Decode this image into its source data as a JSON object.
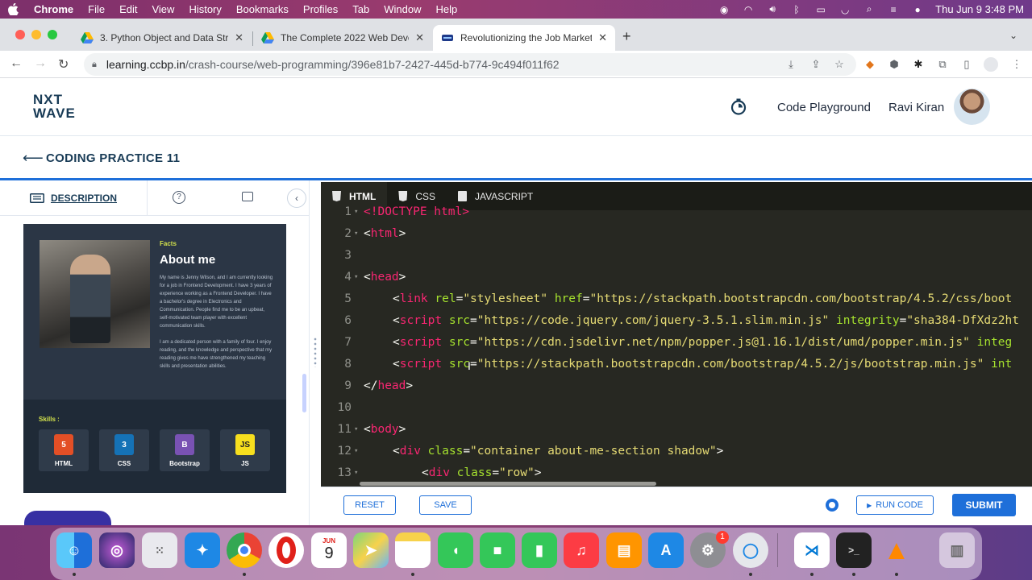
{
  "menubar": {
    "app": "Chrome",
    "items": [
      "File",
      "Edit",
      "View",
      "History",
      "Bookmarks",
      "Profiles",
      "Tab",
      "Window",
      "Help"
    ],
    "clock": "Thu Jun 9  3:48 PM"
  },
  "tabs": [
    {
      "title": "3. Python Object and Data Stru",
      "icon": "google-drive-icon"
    },
    {
      "title": "The Complete 2022 Web Devel",
      "icon": "google-drive-icon"
    },
    {
      "title": "Revolutionizing the Job Market",
      "icon": "ccbp-icon",
      "active": true
    }
  ],
  "address": {
    "host": "learning.ccbp.in",
    "path": "/crash-course/web-programming/396e81b7-2427-445d-b774-9c494f011f62"
  },
  "site": {
    "logo_line1": "NXT",
    "logo_line2": "WAVE",
    "playground": "Code Playground",
    "user": "Ravi Kiran"
  },
  "practice": {
    "title": "CODING PRACTICE 11"
  },
  "description_tab": {
    "label": "DESCRIPTION"
  },
  "preview": {
    "facts": "Facts",
    "heading": "About me",
    "para1": "My name is Jenny Wilson, and I am currently looking for a job in Frontend Development. I have 3 years of experience working as a Frontend Developer. I have a bachelor's degree in Electronics and Communication. People find me to be an upbeat, self-motivated team player with excellent communication skills.",
    "para2": "I am a dedicated person with a family of four. I enjoy reading, and the knowledge and perspective that my reading gives me have strengthened my teaching skills and presentation abilities.",
    "skills_label": "Skills :",
    "skills": [
      {
        "name": "HTML",
        "logo": "5",
        "color": "#e34f26"
      },
      {
        "name": "CSS",
        "logo": "3",
        "color": "#1572b6"
      },
      {
        "name": "Bootstrap",
        "logo": "B",
        "color": "#7952b3"
      },
      {
        "name": "JS",
        "logo": "JS",
        "color": "#f7df1e"
      }
    ]
  },
  "editor": {
    "tabs": [
      "HTML",
      "CSS",
      "JAVASCRIPT"
    ],
    "lines": [
      {
        "n": "1",
        "fold": true,
        "indent": 0,
        "parts": [
          [
            "tag",
            "<!DOCTYPE html>"
          ]
        ]
      },
      {
        "n": "2",
        "fold": true,
        "indent": 0,
        "parts": [
          [
            "punc",
            "<"
          ],
          [
            "tag",
            "html"
          ],
          [
            "punc",
            ">"
          ]
        ]
      },
      {
        "n": "3",
        "fold": false,
        "indent": 0,
        "parts": []
      },
      {
        "n": "4",
        "fold": true,
        "indent": 0,
        "parts": [
          [
            "punc",
            "<"
          ],
          [
            "tag",
            "head"
          ],
          [
            "punc",
            ">"
          ]
        ]
      },
      {
        "n": "5",
        "fold": false,
        "indent": 1,
        "parts": [
          [
            "punc",
            "<"
          ],
          [
            "tag",
            "link "
          ],
          [
            "attr",
            "rel"
          ],
          [
            "punc",
            "="
          ],
          [
            "str",
            "\"stylesheet\" "
          ],
          [
            "attr",
            "href"
          ],
          [
            "punc",
            "="
          ],
          [
            "str",
            "\"https://stackpath.bootstrapcdn.com/bootstrap/4.5.2/css/boot"
          ]
        ]
      },
      {
        "n": "6",
        "fold": false,
        "indent": 1,
        "parts": [
          [
            "punc",
            "<"
          ],
          [
            "tag",
            "script "
          ],
          [
            "attr",
            "src"
          ],
          [
            "punc",
            "="
          ],
          [
            "str",
            "\"https://code.jquery.com/jquery-3.5.1.slim.min.js\" "
          ],
          [
            "attr",
            "integrity"
          ],
          [
            "punc",
            "="
          ],
          [
            "str",
            "\"sha384-DfXdz2ht"
          ]
        ]
      },
      {
        "n": "7",
        "fold": false,
        "indent": 1,
        "parts": [
          [
            "punc",
            "<"
          ],
          [
            "tag",
            "script "
          ],
          [
            "attr",
            "src"
          ],
          [
            "punc",
            "="
          ],
          [
            "str",
            "\"https://cdn.jsdelivr.net/npm/popper.js@1.16.1/dist/umd/popper.min.js\" "
          ],
          [
            "attr",
            "integ"
          ]
        ]
      },
      {
        "n": "8",
        "fold": false,
        "indent": 1,
        "parts": [
          [
            "punc",
            "<"
          ],
          [
            "tag",
            "script "
          ],
          [
            "attr",
            "src"
          ],
          [
            "punc",
            "="
          ],
          [
            "str",
            "\"https://stackpath.bootstrapcdn.com/bootstrap/4.5.2/js/bootstrap.min.js\" "
          ],
          [
            "attr",
            "int"
          ]
        ]
      },
      {
        "n": "9",
        "fold": false,
        "indent": 0,
        "parts": [
          [
            "punc",
            "</"
          ],
          [
            "tag",
            "head"
          ],
          [
            "punc",
            ">"
          ]
        ]
      },
      {
        "n": "10",
        "fold": false,
        "indent": 0,
        "parts": []
      },
      {
        "n": "11",
        "fold": true,
        "indent": 0,
        "parts": [
          [
            "punc",
            "<"
          ],
          [
            "tag",
            "body"
          ],
          [
            "punc",
            ">"
          ]
        ]
      },
      {
        "n": "12",
        "fold": true,
        "indent": 1,
        "parts": [
          [
            "punc",
            "<"
          ],
          [
            "tag",
            "div "
          ],
          [
            "attr",
            "class"
          ],
          [
            "punc",
            "="
          ],
          [
            "str",
            "\"container about-me-section shadow\""
          ],
          [
            "punc",
            ">"
          ]
        ]
      },
      {
        "n": "13",
        "fold": true,
        "indent": 2,
        "parts": [
          [
            "punc",
            "<"
          ],
          [
            "tag",
            "div "
          ],
          [
            "attr",
            "class"
          ],
          [
            "punc",
            "="
          ],
          [
            "str",
            "\"row\""
          ],
          [
            "punc",
            ">"
          ]
        ]
      }
    ]
  },
  "actions": {
    "reset": "RESET",
    "save": "SAVE",
    "run": "RUN CODE",
    "submit": "SUBMIT"
  },
  "dock": {
    "calendar_month": "JUN",
    "calendar_day": "9",
    "badge": "1"
  }
}
